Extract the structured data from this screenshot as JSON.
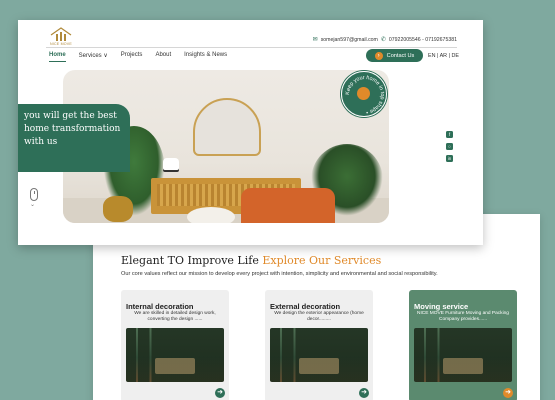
{
  "header": {
    "logo_text": "NICE MOVE",
    "email": "somejan597@gmail.com",
    "phones": "07922005546 - 07192675381",
    "contact_button": "Contact Us",
    "contact_button_icon": "arrow-right-icon",
    "languages": "EN | AR | DE",
    "accent_color": "#2e6f58",
    "orange_color": "#e08a2a"
  },
  "nav": {
    "items": [
      {
        "label": "Home",
        "active": true
      },
      {
        "label": "Services ∨",
        "active": false
      },
      {
        "label": "Projects",
        "active": false
      },
      {
        "label": "About",
        "active": false
      },
      {
        "label": "Insights & News",
        "active": false
      }
    ]
  },
  "hero": {
    "tagline": "you will get the best home transformation with us",
    "badge_text": "Keep your home in top shape •",
    "socials": [
      "facebook-icon",
      "instagram-icon",
      "linkedin-icon"
    ]
  },
  "services": {
    "title_main": "Elegant TO Improve Life",
    "title_accent": "Explore Our Services",
    "subtitle": "Our core values reflect our mission to develop every project with intention, simplicity and environmental and social responsibility.",
    "cards": [
      {
        "name": "Internal decoration",
        "desc": "We are skilled in detailed design work, converting the design ......",
        "highlight": false
      },
      {
        "name": "External decoration",
        "desc": "We design the exterior appearance (home decor.........",
        "highlight": false
      },
      {
        "name": "Moving service",
        "desc": "NICE MOVE Furniture Moving and Packing Company provides......",
        "highlight": true
      }
    ]
  }
}
